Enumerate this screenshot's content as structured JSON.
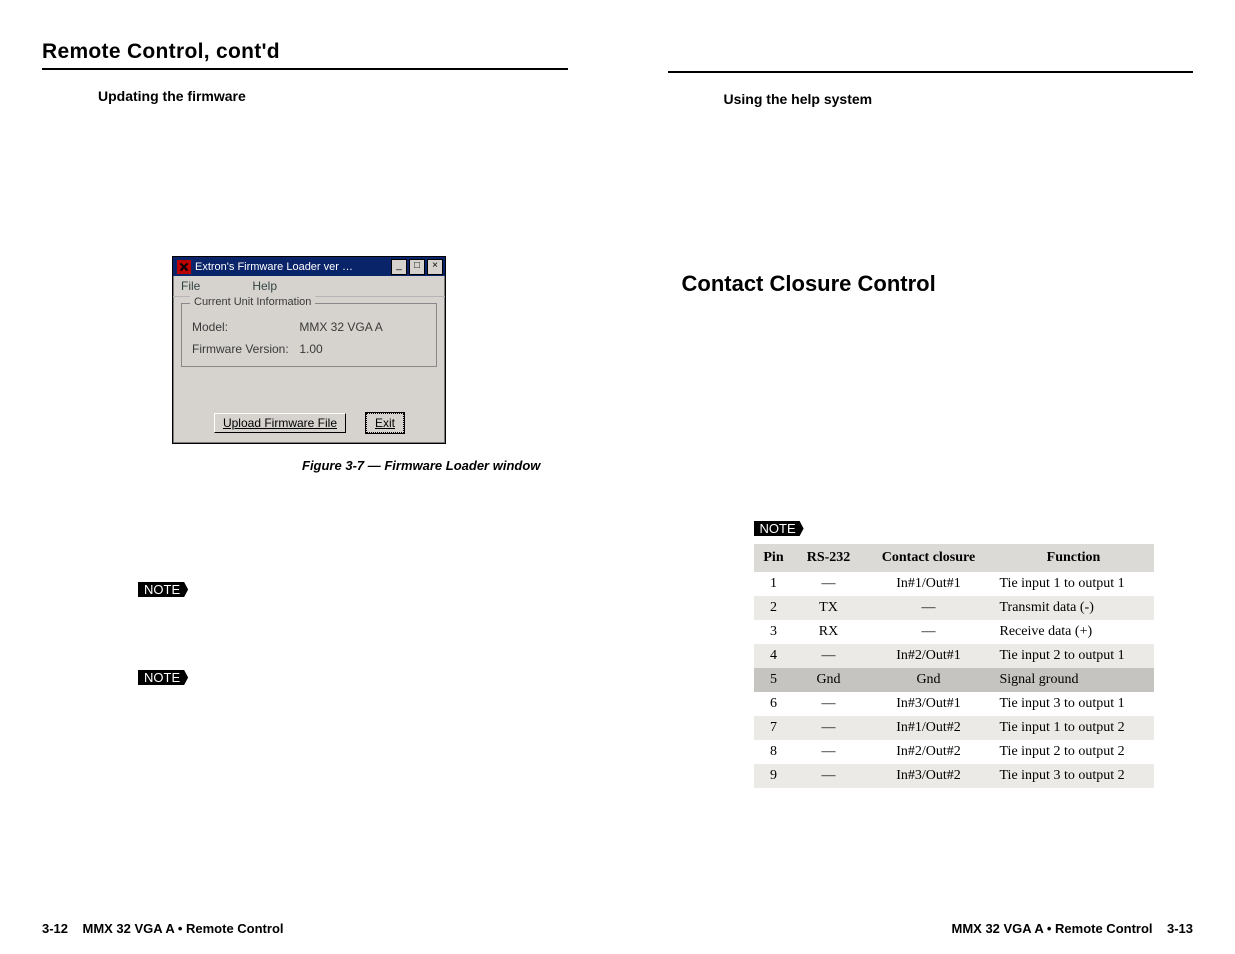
{
  "left": {
    "title": "Remote Control, cont'd",
    "subhead": "Updating the firmware",
    "window": {
      "title": "Extron's Firmware Loader   ver …",
      "menu_file": "File",
      "menu_help": "Help",
      "group_legend": "Current Unit Information",
      "model_label": "Model:",
      "model_value": "MMX 32 VGA A",
      "fw_label": "Firmware Version:",
      "fw_value": "1.00",
      "btn_upload": "Upload Firmware File",
      "btn_exit": "Exit"
    },
    "caption": "Figure 3-7 — Firmware Loader window",
    "note": "NOTE",
    "footer_num": "3-12",
    "footer_text": "MMX 32 VGA A • Remote Control"
  },
  "right": {
    "subhead": "Using the help system",
    "h2": "Contact Closure Control",
    "note": "NOTE",
    "table": {
      "headers": {
        "pin": "Pin",
        "rs232": "RS-232",
        "cc": "Contact closure",
        "fn": "Function"
      },
      "rows": [
        {
          "pin": "1",
          "rs232": "—",
          "cc": "In#1/Out#1",
          "fn": "Tie input 1 to output 1",
          "stripe": false
        },
        {
          "pin": "2",
          "rs232": "TX",
          "cc": "—",
          "fn": "Transmit data (-)",
          "stripe": true
        },
        {
          "pin": "3",
          "rs232": "RX",
          "cc": "—",
          "fn": "Receive data (+)",
          "stripe": false
        },
        {
          "pin": "4",
          "rs232": "—",
          "cc": "In#2/Out#1",
          "fn": "Tie input 2 to output 1",
          "stripe": true
        },
        {
          "pin": "5",
          "rs232": "Gnd",
          "cc": "Gnd",
          "fn": "Signal ground",
          "gnd": true
        },
        {
          "pin": "6",
          "rs232": "—",
          "cc": "In#3/Out#1",
          "fn": "Tie input 3 to output 1",
          "stripe": false
        },
        {
          "pin": "7",
          "rs232": "—",
          "cc": "In#1/Out#2",
          "fn": "Tie input 1 to output 2",
          "stripe": true
        },
        {
          "pin": "8",
          "rs232": "—",
          "cc": "In#2/Out#2",
          "fn": "Tie input 2 to output 2",
          "stripe": false
        },
        {
          "pin": "9",
          "rs232": "—",
          "cc": "In#3/Out#2",
          "fn": "Tie input 3 to output 2",
          "stripe": true
        }
      ]
    },
    "footer_text": "MMX 32 VGA A • Remote Control",
    "footer_num": "3-13"
  }
}
